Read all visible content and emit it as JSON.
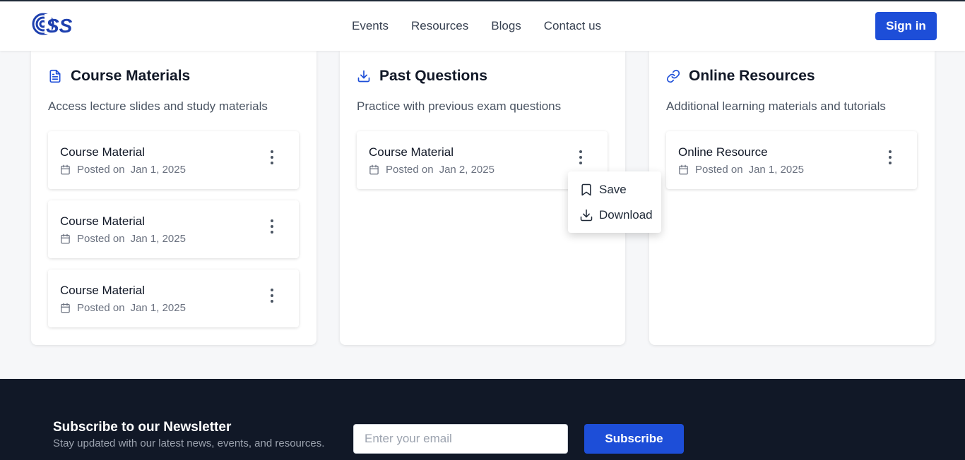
{
  "header": {
    "logo_text": "CSS",
    "nav": [
      {
        "label": "Events"
      },
      {
        "label": "Resources"
      },
      {
        "label": "Blogs"
      },
      {
        "label": "Contact us"
      }
    ],
    "signin_label": "Sign in"
  },
  "cards": [
    {
      "title": "Course Materials",
      "icon": "document-icon",
      "description": "Access lecture slides and study materials",
      "items": [
        {
          "title": "Course Material",
          "posted_label": "Posted on",
          "date": "Jan 1, 2025"
        },
        {
          "title": "Course Material",
          "posted_label": "Posted on",
          "date": "Jan 1, 2025"
        },
        {
          "title": "Course Material",
          "posted_label": "Posted on",
          "date": "Jan 1, 2025"
        }
      ]
    },
    {
      "title": "Past Questions",
      "icon": "download-icon",
      "description": "Practice with previous exam questions",
      "items": [
        {
          "title": "Course Material",
          "posted_label": "Posted on",
          "date": "Jan 2, 2025"
        }
      ]
    },
    {
      "title": "Online Resources",
      "icon": "link-icon",
      "description": "Additional learning materials and tutorials",
      "items": [
        {
          "title": "Online Resource",
          "posted_label": "Posted on",
          "date": "Jan 1, 2025"
        }
      ]
    }
  ],
  "dropdown": {
    "items": [
      {
        "label": "Save",
        "icon": "bookmark-icon"
      },
      {
        "label": "Download",
        "icon": "download-icon"
      }
    ]
  },
  "footer": {
    "newsletter_title": "Subscribe to our Newsletter",
    "newsletter_subtitle": "Stay updated with our latest news, events, and resources.",
    "email_placeholder": "Enter your email",
    "subscribe_label": "Subscribe"
  },
  "colors": {
    "accent": "#1d4ed8",
    "footer_bg": "#111827",
    "page_bg": "#f6f7f9"
  }
}
